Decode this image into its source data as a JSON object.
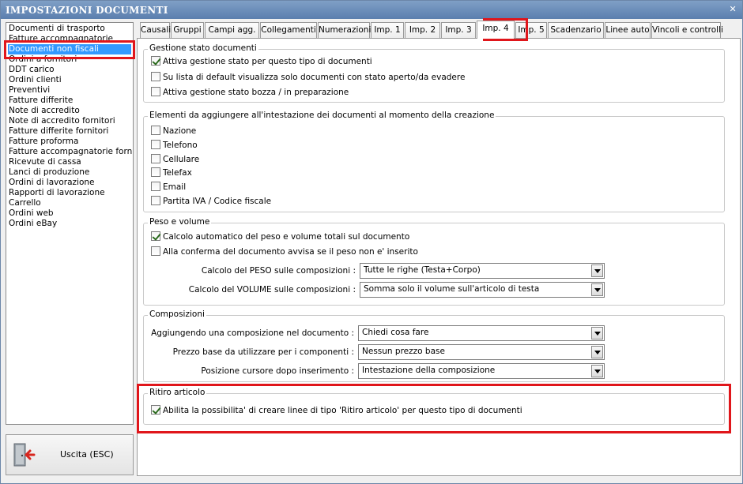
{
  "window": {
    "title": "IMPOSTAZIONI DOCUMENTI",
    "close": "✕"
  },
  "doc_list": {
    "items": [
      "Documenti di trasporto",
      "Fatture accompagnatorie",
      "Documenti non fiscali",
      "Ordini a fornitori",
      "DDT carico",
      "Ordini clienti",
      "Preventivi",
      "Fatture differite",
      "Note di accredito",
      "Note di accredito fornitori",
      "Fatture differite fornitori",
      "Fatture proforma",
      "Fatture accompagnatorie fornito",
      "Ricevute di cassa",
      "Lanci di produzione",
      "Ordini di lavorazione",
      "Rapporti di lavorazione",
      "Carrello",
      "Ordini web",
      "Ordini eBay"
    ],
    "selected": "Documenti non fiscali"
  },
  "exit_button": {
    "label": "Uscita (ESC)",
    "icon": "exit-door-icon"
  },
  "tabs": [
    "Causali",
    "Gruppi",
    "Campi agg.",
    "Collegamenti",
    "Numerazioni",
    "Imp. 1",
    "Imp. 2",
    "Imp. 3",
    "Imp. 4",
    "Imp. 5",
    "Scadenzario",
    "Linee auto",
    "Vincoli e controlli"
  ],
  "active_tab": "Imp. 4",
  "gestione_stato": {
    "title": "Gestione stato documenti",
    "options": [
      {
        "label": "Attiva gestione stato per questo tipo di documenti",
        "checked": true
      },
      {
        "label": "Su lista di default visualizza solo documenti con stato aperto/da evadere",
        "checked": false
      },
      {
        "label": "Attiva gestione stato bozza / in preparazione",
        "checked": false
      }
    ]
  },
  "intestazione": {
    "title": "Elementi da aggiungere all'intestazione dei documenti al momento della creazione",
    "options": [
      {
        "label": "Nazione",
        "checked": false
      },
      {
        "label": "Telefono",
        "checked": false
      },
      {
        "label": "Cellulare",
        "checked": false
      },
      {
        "label": "Telefax",
        "checked": false
      },
      {
        "label": "Email",
        "checked": false
      },
      {
        "label": "Partita IVA / Codice fiscale",
        "checked": false
      }
    ]
  },
  "peso_volume": {
    "title": "Peso e volume",
    "options": [
      {
        "label": "Calcolo automatico del peso e volume totali sul documento",
        "checked": true
      },
      {
        "label": "Alla conferma del documento avvisa se il peso non e' inserito",
        "checked": false
      }
    ],
    "fields": [
      {
        "label": "Calcolo del PESO sulle composizioni :",
        "value": "Tutte le righe (Testa+Corpo)"
      },
      {
        "label": "Calcolo del VOLUME sulle composizioni :",
        "value": "Somma solo il volume sull'articolo di testa"
      }
    ]
  },
  "composizioni": {
    "title": "Composizioni",
    "fields": [
      {
        "label": "Aggiungendo una composizione nel documento :",
        "value": "Chiedi cosa fare"
      },
      {
        "label": "Prezzo base da utilizzare per i componenti :",
        "value": "Nessun prezzo base"
      },
      {
        "label": "Posizione cursore dopo inserimento :",
        "value": "Intestazione della composizione"
      }
    ]
  },
  "ritiro": {
    "title": "Ritiro articolo",
    "option": {
      "label": "Abilita la possibilita' di creare linee di tipo 'Ritiro articolo' per questo tipo di documenti",
      "checked": true
    }
  },
  "colors": {
    "highlight": "#e0161b",
    "selection": "#3399ff",
    "titlebar": "#5b7fae"
  }
}
